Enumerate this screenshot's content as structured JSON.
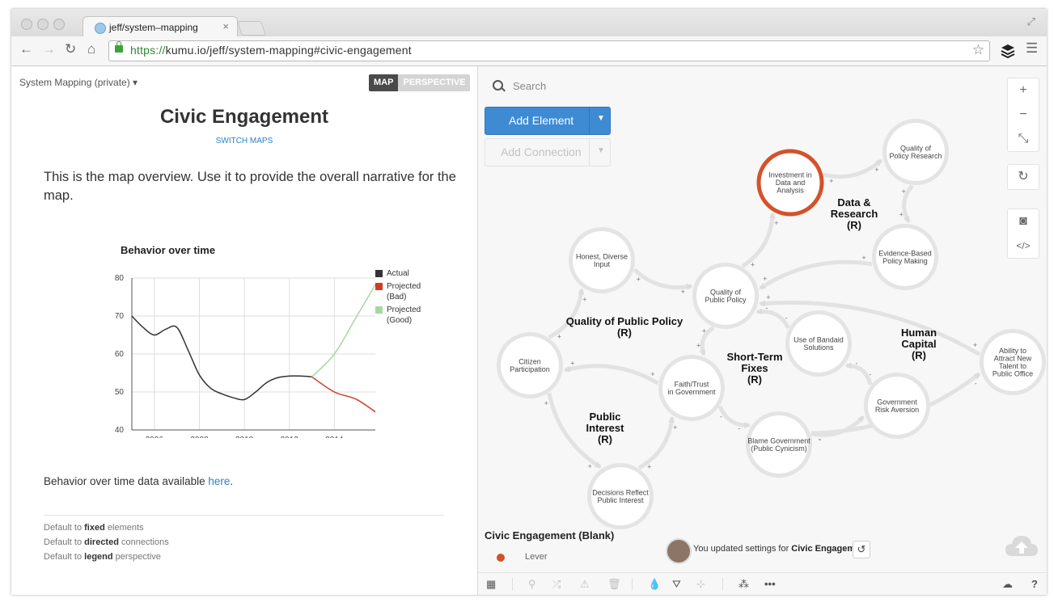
{
  "browser": {
    "tab_title": "jeff/system–mapping",
    "url_scheme": "https://",
    "url_rest": "kumu.io/jeff/system-mapping#civic-engagement"
  },
  "left": {
    "map_name": "System Mapping (private)",
    "toggle_map": "MAP",
    "toggle_perspective": "PERSPECTIVE",
    "title": "Civic Engagement",
    "switch_maps": "SWITCH MAPS",
    "intro": "This is the map overview. Use it to provide the overall narrative for the map.",
    "note_prefix": "Behavior over time data available ",
    "note_link": "here",
    "note_suffix": ".",
    "defaults": [
      {
        "pre": "Default to ",
        "bold": "fixed",
        "post": " elements"
      },
      {
        "pre": "Default to ",
        "bold": "directed",
        "post": " connections"
      },
      {
        "pre": "Default to ",
        "bold": "legend",
        "post": " perspective"
      }
    ]
  },
  "chart_data": {
    "type": "line",
    "title": "Behavior over time",
    "xlabel": "",
    "ylabel": "",
    "xlim": [
      2005,
      2016
    ],
    "ylim": [
      40,
      80
    ],
    "x_ticks": [
      2006,
      2008,
      2010,
      2012,
      2014
    ],
    "y_ticks": [
      40,
      50,
      60,
      70,
      80
    ],
    "grid": true,
    "legend_position": "right",
    "series": [
      {
        "name": "Actual",
        "color": "#333333",
        "x": [
          2005,
          2005.5,
          2006,
          2006.5,
          2007,
          2007.5,
          2008,
          2008.5,
          2009,
          2009.5,
          2010,
          2010.5,
          2011,
          2011.5,
          2012,
          2012.5,
          2013
        ],
        "y": [
          70,
          67,
          65,
          66.5,
          67,
          61,
          54.5,
          51,
          49.5,
          48.5,
          48,
          50,
          52.5,
          53.8,
          54.2,
          54.2,
          54
        ]
      },
      {
        "name": "Projected (Bad)",
        "color": "#d13b25",
        "x": [
          2013,
          2014,
          2015,
          2016
        ],
        "y": [
          54,
          50,
          48,
          44
        ]
      },
      {
        "name": "Projected (Good)",
        "color": "#a7d7a1",
        "x": [
          2013,
          2014,
          2015,
          2016
        ],
        "y": [
          54,
          60,
          70,
          80
        ]
      }
    ]
  },
  "legend_labels": [
    {
      "line1": "Actual",
      "line2": ""
    },
    {
      "line1": "Projected",
      "line2": "(Bad)"
    },
    {
      "line1": "Projected",
      "line2": "(Good)"
    }
  ],
  "right": {
    "search_placeholder": "Search",
    "add_element": "Add Element",
    "add_connection": "Add Connection",
    "map_bottom_title": "Civic Engagement (Blank)",
    "legend_lever": "Lever",
    "activity_pre": "You updated settings for ",
    "activity_bold": "Civic Engagement"
  },
  "graph": {
    "lever_color": "#d4522a",
    "nodes": [
      {
        "id": "invest",
        "lines": [
          "Investment in",
          "Data and",
          "Analysis"
        ],
        "lever": true
      },
      {
        "id": "quality_research",
        "lines": [
          "Quality of",
          "Policy Research"
        ]
      },
      {
        "id": "evidence",
        "lines": [
          "Evidence-Based",
          "Policy Making"
        ]
      },
      {
        "id": "honest",
        "lines": [
          "Honest, Diverse",
          "Input"
        ]
      },
      {
        "id": "quality_policy",
        "lines": [
          "Quality of",
          "Public Policy"
        ]
      },
      {
        "id": "citizen",
        "lines": [
          "Citizen",
          "Participation"
        ]
      },
      {
        "id": "faith",
        "lines": [
          "Faith/Trust",
          "in Government"
        ]
      },
      {
        "id": "bandaid",
        "lines": [
          "Use of Bandaid",
          "Solutions"
        ]
      },
      {
        "id": "ability",
        "lines": [
          "Ability to",
          "Attract New",
          "Talent to",
          "Public Office"
        ]
      },
      {
        "id": "risk",
        "lines": [
          "Government",
          "Risk Aversion"
        ]
      },
      {
        "id": "blame",
        "lines": [
          "Blame Government",
          "(Public Cynicism)"
        ]
      },
      {
        "id": "decisions",
        "lines": [
          "Decisions Reflect",
          "Public Interest"
        ]
      }
    ],
    "loop_labels": [
      {
        "id": "data_research",
        "lines": [
          "Data &",
          "Research",
          "(R)"
        ]
      },
      {
        "id": "quality_loop",
        "lines": [
          "Quality of Public Policy",
          "(R)"
        ]
      },
      {
        "id": "short_term",
        "lines": [
          "Short-Term",
          "Fixes",
          "(R)"
        ]
      },
      {
        "id": "human_capital",
        "lines": [
          "Human",
          "Capital",
          "(R)"
        ]
      },
      {
        "id": "public_interest",
        "lines": [
          "Public",
          "Interest",
          "(R)"
        ]
      }
    ],
    "edges": [
      {
        "from": "invest",
        "to": "quality_research",
        "sign": "+"
      },
      {
        "from": "quality_research",
        "to": "evidence",
        "sign": "+"
      },
      {
        "from": "evidence",
        "to": "quality_policy",
        "sign": "+"
      },
      {
        "from": "quality_policy",
        "to": "invest",
        "sign": "+"
      },
      {
        "from": "honest",
        "to": "quality_policy",
        "sign": "+"
      },
      {
        "from": "citizen",
        "to": "honest",
        "sign": "+"
      },
      {
        "from": "quality_policy",
        "to": "faith",
        "sign": "+"
      },
      {
        "from": "faith",
        "to": "citizen",
        "sign": "+"
      },
      {
        "from": "citizen",
        "to": "decisions",
        "sign": "+"
      },
      {
        "from": "decisions",
        "to": "faith",
        "sign": "+"
      },
      {
        "from": "faith",
        "to": "blame",
        "sign": "-"
      },
      {
        "from": "blame",
        "to": "risk",
        "sign": "-"
      },
      {
        "from": "risk",
        "to": "bandaid",
        "sign": "-"
      },
      {
        "from": "bandaid",
        "to": "quality_policy",
        "sign": "-"
      },
      {
        "from": "blame",
        "to": "ability",
        "sign": "-"
      },
      {
        "from": "ability",
        "to": "quality_policy",
        "sign": "+"
      }
    ]
  }
}
